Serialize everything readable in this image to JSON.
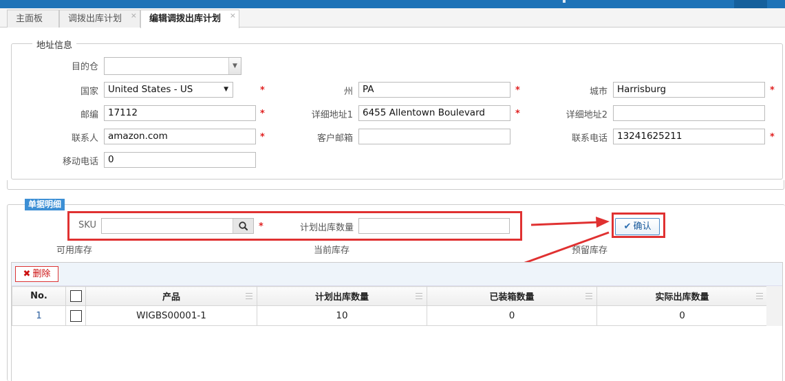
{
  "tabs": [
    {
      "label": "主面板"
    },
    {
      "label": "调拨出库计划",
      "close": "×"
    },
    {
      "label": "编辑调拨出库计划",
      "close": "×"
    }
  ],
  "address": {
    "legend": "地址信息",
    "dest_label": "目的仓",
    "dest_value": "",
    "country_label": "国家",
    "country_value": "United States - US",
    "state_label": "州",
    "state_value": "PA",
    "city_label": "城市",
    "city_value": "Harrisburg",
    "zip_label": "邮编",
    "zip_value": "17112",
    "addr1_label": "详细地址1",
    "addr1_value": "6455 Allentown Boulevard",
    "addr2_label": "详细地址2",
    "addr2_value": "",
    "contact_label": "联系人",
    "contact_value": "amazon.com",
    "email_label": "客户邮箱",
    "email_value": "",
    "phone_label": "联系电话",
    "phone_value": "13241625211",
    "mobile_label": "移动电话",
    "mobile_value": "0",
    "required_mark": "*"
  },
  "detail": {
    "tag": "单据明细",
    "sku_label": "SKU",
    "sku_value": "",
    "qty_label": "计划出库数量",
    "qty_value": "",
    "confirm_label": "确认",
    "available_label": "可用库存",
    "current_label": "当前库存",
    "reserved_label": "预留库存"
  },
  "grid": {
    "delete_label": "删除",
    "columns": [
      "No.",
      "",
      "产品",
      "计划出库数量",
      "已装箱数量",
      "实际出库数量"
    ],
    "rows": [
      {
        "no": "1",
        "product": "WIGBS00001-1",
        "planned": "10",
        "packed": "0",
        "actual": "0"
      }
    ]
  },
  "colors": {
    "topbar": "#1f73b7",
    "accent_red": "#e03131",
    "panel_tag": "#3c8fd5"
  }
}
